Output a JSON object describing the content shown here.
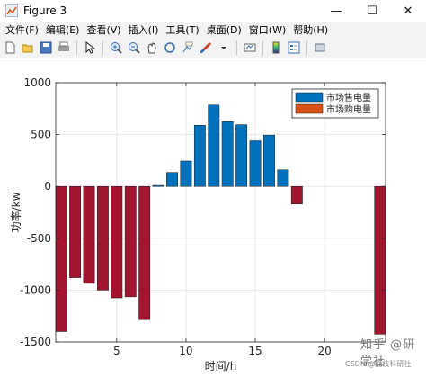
{
  "window": {
    "title": "Figure 3",
    "minimize": "—",
    "maximize": "☐",
    "close": "✕"
  },
  "menu": {
    "items": [
      "文件(F)",
      "编辑(E)",
      "查看(V)",
      "插入(I)",
      "工具(T)",
      "桌面(D)",
      "窗口(W)",
      "帮助(H)"
    ]
  },
  "toolbar": {
    "icons": [
      "new-figure-icon",
      "open-file-icon",
      "save-icon",
      "print-icon",
      "edit-plot-icon",
      "zoom-in-icon",
      "zoom-out-icon",
      "pan-icon",
      "rotate-3d-icon",
      "data-cursor-icon",
      "brush-icon",
      "link-plot-icon",
      "colorbar-icon",
      "legend-icon",
      "hide-plot-tools-icon"
    ]
  },
  "colors": {
    "sell": "#0072BD",
    "buy_bar": "#A2142F",
    "buy_legend": "#D95319",
    "grid": "#e6e6e6"
  },
  "watermark": {
    "text": "知乎 @研学社",
    "credit": "CSDN @荔枝科研社"
  },
  "chart_data": {
    "type": "bar",
    "title": "",
    "xlabel": "时间/h",
    "ylabel": "功率/kw",
    "xlim": [
      0.6,
      24.4
    ],
    "ylim": [
      -1500,
      1000
    ],
    "xticks": [
      5,
      10,
      15,
      20
    ],
    "yticks": [
      -1500,
      -1000,
      -500,
      0,
      500,
      1000
    ],
    "grid": true,
    "legend_position": "top-right",
    "series": [
      {
        "name": "市场售电量",
        "x": [
          8,
          9,
          10,
          11,
          12,
          13,
          14,
          15,
          16,
          17
        ],
        "values": [
          10,
          135,
          245,
          590,
          785,
          625,
          595,
          440,
          495,
          160
        ]
      },
      {
        "name": "市场购电量",
        "x": [
          1,
          2,
          3,
          4,
          5,
          6,
          7,
          18,
          24
        ],
        "values": [
          -1400,
          -880,
          -935,
          -1000,
          -1075,
          -1065,
          -1285,
          -170,
          -1425
        ]
      }
    ]
  }
}
